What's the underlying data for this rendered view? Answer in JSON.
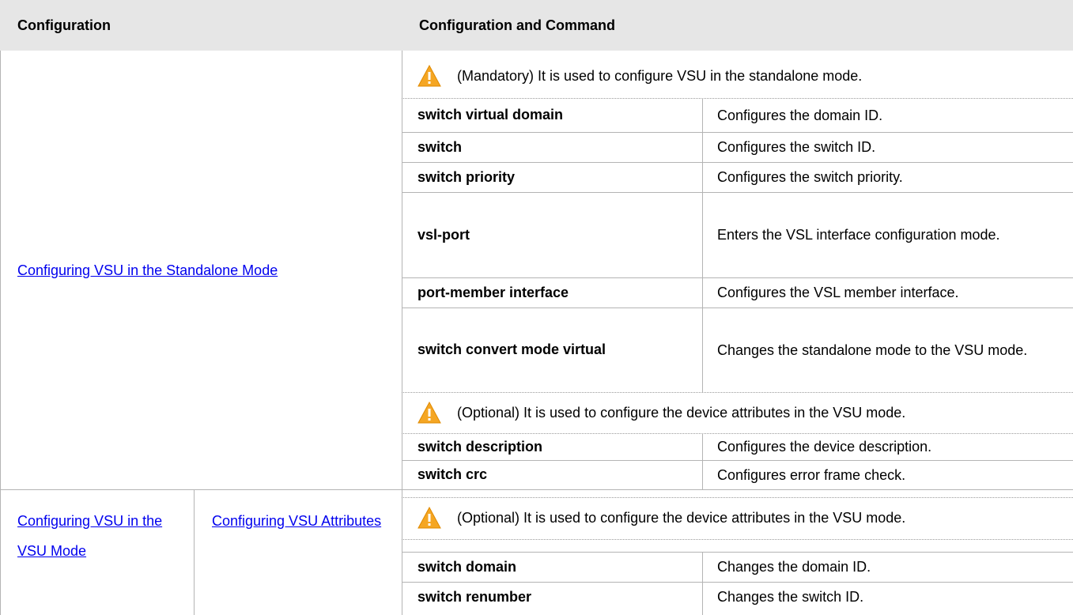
{
  "headers": {
    "configuration": "Configuration",
    "command": "Configuration and Command"
  },
  "left": {
    "standalone_link": "Configuring VSU in the Standalone Mode",
    "vsu_mode_link": "Configuring VSU in the VSU Mode",
    "vsu_attributes_link": "Configuring VSU Attributes"
  },
  "sections": [
    {
      "note": "(Mandatory) It is used to configure VSU in the standalone mode.",
      "rows": [
        {
          "command": "switch virtual domain",
          "description": "Configures the domain ID."
        },
        {
          "command": "switch",
          "description": "Configures the switch ID."
        },
        {
          "command": "switch priority",
          "description": "Configures the switch priority."
        },
        {
          "command": "vsl-port",
          "description": "Enters the VSL interface configuration mode."
        },
        {
          "command": "port-member interface",
          "description": "Configures the VSL member interface."
        },
        {
          "command": "switch convert mode virtual",
          "description": "Changes the standalone mode to the VSU mode."
        }
      ]
    },
    {
      "note": "(Optional) It is used to configure the device attributes in the VSU mode.",
      "rows": [
        {
          "command": "switch description",
          "description": "Configures the device description."
        },
        {
          "command": "switch crc",
          "description": "Configures error frame check."
        }
      ]
    },
    {
      "note": "(Optional) It is used to configure the device attributes in the VSU mode.",
      "rows": [
        {
          "command": "switch domain",
          "description": "Changes the domain ID."
        },
        {
          "command": "switch renumber",
          "description": "Changes the switch ID."
        }
      ]
    }
  ],
  "colors": {
    "header_bg": "#e6e6e6",
    "link": "#0000ee",
    "warning": "#f5a623",
    "border": "#b4b4b4"
  },
  "icons": {
    "warning": "warning-icon"
  }
}
